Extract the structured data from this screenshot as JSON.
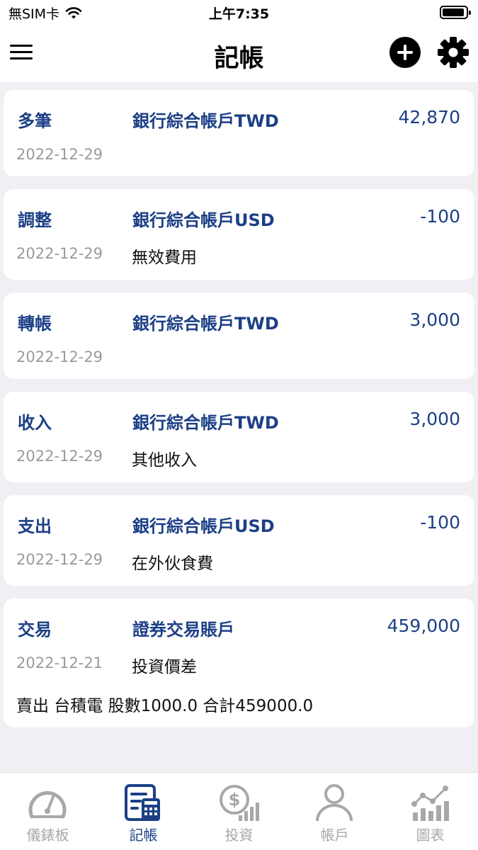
{
  "status_bar": {
    "carrier": "無SIM卡",
    "time": "上午7:35"
  },
  "nav": {
    "title": "記帳",
    "icons": [
      "menu-icon",
      "add-icon",
      "gear-icon"
    ]
  },
  "transactions": [
    {
      "type": "多筆",
      "account": "銀行綜合帳戶TWD",
      "amount": "42,870",
      "date": "2022-12-29",
      "category": "",
      "note": ""
    },
    {
      "type": "調整",
      "account": "銀行綜合帳戶USD",
      "amount": "-100",
      "date": "2022-12-29",
      "category": "無效費用",
      "note": ""
    },
    {
      "type": "轉帳",
      "account": "銀行綜合帳戶TWD",
      "amount": "3,000",
      "date": "2022-12-29",
      "category": "",
      "note": ""
    },
    {
      "type": "收入",
      "account": "銀行綜合帳戶TWD",
      "amount": "3,000",
      "date": "2022-12-29",
      "category": "其他收入",
      "note": ""
    },
    {
      "type": "支出",
      "account": "銀行綜合帳戶USD",
      "amount": "-100",
      "date": "2022-12-29",
      "category": "在外伙食費",
      "note": ""
    },
    {
      "type": "交易",
      "account": "證券交易賬戶",
      "amount": "459,000",
      "date": "2022-12-21",
      "category": "投資價差",
      "note": "賣出 台積電 股數1000.0 合計459000.0"
    }
  ],
  "tabs": [
    {
      "label": "儀錶板",
      "icon": "dashboard-icon",
      "active": false
    },
    {
      "label": "記帳",
      "icon": "ledger-icon",
      "active": true
    },
    {
      "label": "投資",
      "icon": "investment-icon",
      "active": false
    },
    {
      "label": "帳戶",
      "icon": "account-icon",
      "active": false
    },
    {
      "label": "圖表",
      "icon": "chart-icon",
      "active": false
    }
  ],
  "colors": {
    "accent": "#1c3f86",
    "inactive": "#a8a8a8",
    "background": "#efeff4"
  }
}
